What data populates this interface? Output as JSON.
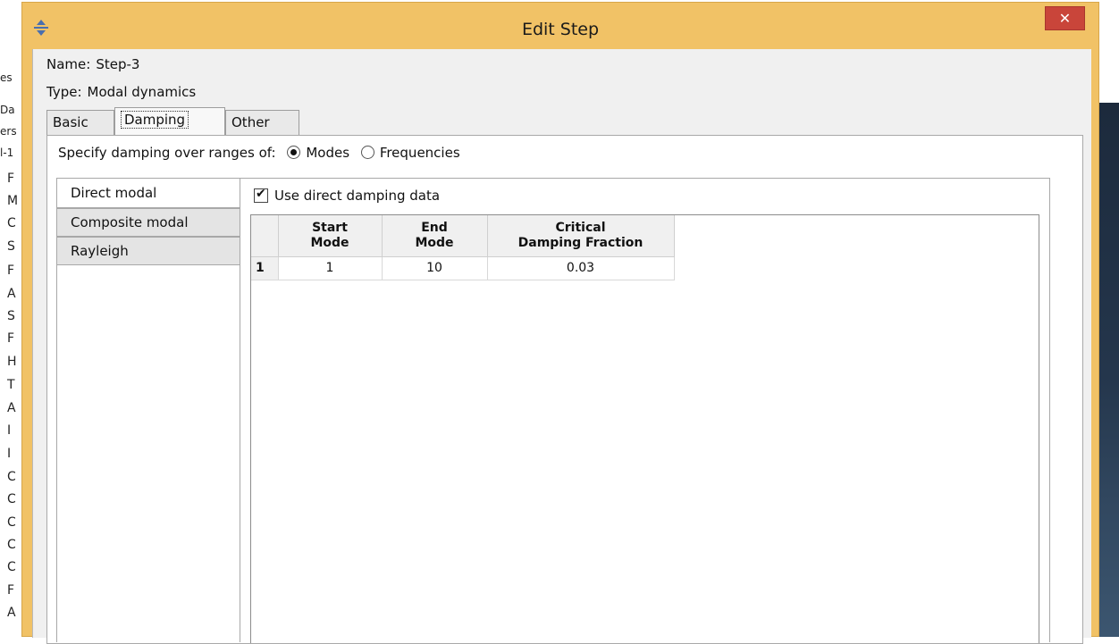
{
  "background_app": {
    "left_fragments": [
      "es",
      "Da",
      "ers",
      "l-1",
      "F",
      "M",
      "C",
      "S",
      "F",
      "A",
      "S",
      "F",
      "H",
      "T",
      "A",
      "I",
      "I",
      "C",
      "C",
      "C",
      "C",
      "C",
      "F",
      "A"
    ]
  },
  "dialog": {
    "title": "Edit Step",
    "app_icon": "move-arrows-icon",
    "close_icon": "close-icon",
    "close_glyph": "✕",
    "name_label": "Name:",
    "name_value": "Step-3",
    "type_label": "Type:",
    "type_value": "Modal dynamics",
    "tabs": [
      {
        "label": "Basic",
        "active": false
      },
      {
        "label": "Damping",
        "active": true
      },
      {
        "label": "Other",
        "active": false
      }
    ]
  },
  "damping": {
    "specify_label": "Specify damping over ranges of:",
    "options": [
      {
        "label": "Modes",
        "selected": true
      },
      {
        "label": "Frequencies",
        "selected": false
      }
    ],
    "side_tabs": [
      {
        "label": "Direct modal",
        "selected": true
      },
      {
        "label": "Composite modal",
        "selected": false
      },
      {
        "label": "Rayleigh",
        "selected": false
      }
    ],
    "use_direct": {
      "label": "Use direct damping data",
      "checked": true
    },
    "table": {
      "columns": [
        [
          "Start",
          "Mode"
        ],
        [
          "End",
          "Mode"
        ],
        [
          "Critical",
          "Damping Fraction"
        ]
      ],
      "rows": [
        {
          "index": "1",
          "cells": [
            "1",
            "10",
            "0.03"
          ]
        }
      ]
    }
  },
  "colors": {
    "title_bar": "#f1c266",
    "close_button": "#c9453a",
    "client_bg": "#f0f0f0",
    "panel_bg": "#ffffff"
  }
}
